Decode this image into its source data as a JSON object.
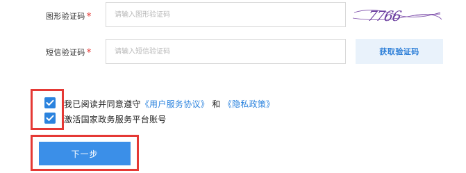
{
  "form": {
    "captcha_row": {
      "label": "图形验证码",
      "required_mark": "*",
      "placeholder": "请输入图形验证码",
      "captcha_text": "7766"
    },
    "sms_row": {
      "label": "短信验证码",
      "required_mark": "*",
      "placeholder": "请输入短信验证码",
      "get_code_label": "获取验证码"
    }
  },
  "agreements": {
    "agree_prefix": "我已阅读并同意遵守",
    "user_agreement": "《用户服务协议》",
    "and": "和",
    "privacy_policy": "《隐私政策》",
    "activate_label": "激活国家政务服务平台账号"
  },
  "actions": {
    "next_label": "下一步"
  },
  "colors": {
    "primary": "#3b8fe8",
    "required": "#e53935",
    "highlight_box": "#e53935",
    "link": "#2b83de",
    "sms_button_bg": "#e9f2fb"
  }
}
